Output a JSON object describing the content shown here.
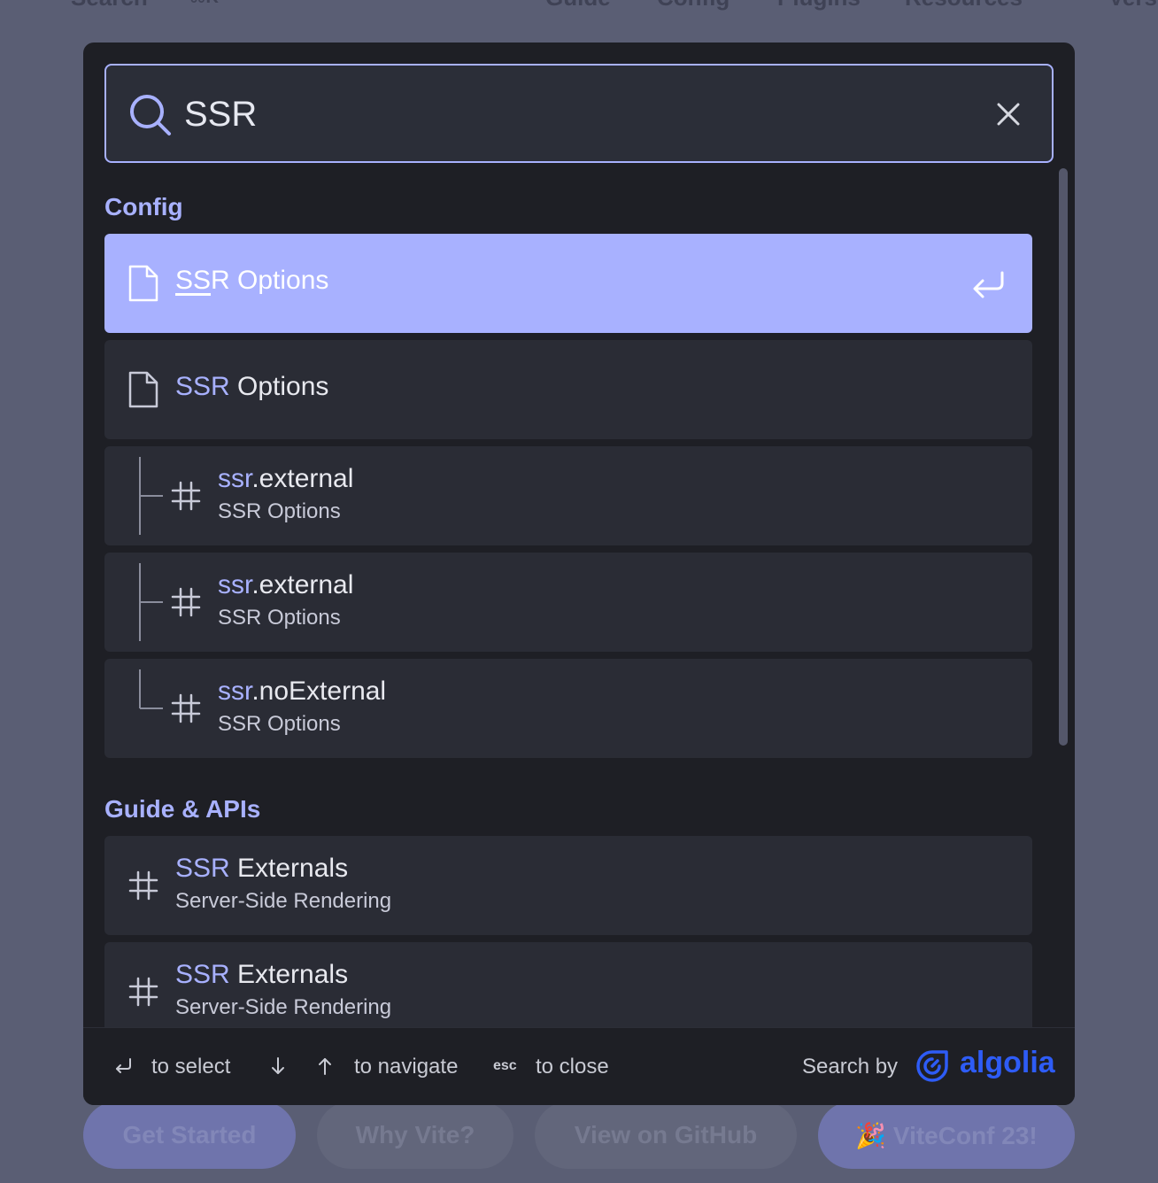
{
  "background": {
    "nav": [
      "Search",
      "⌘K",
      "Guide",
      "Config",
      "Plugins",
      "Resources",
      "Vers"
    ],
    "buttons": [
      "Get Started",
      "Why Vite?",
      "View on GitHub",
      "🎉 ViteConf 23!"
    ]
  },
  "search": {
    "query": "SSR",
    "icon": "search-icon",
    "clear_icon": "close-icon"
  },
  "sections": [
    {
      "title": "Config",
      "items": [
        {
          "type": "page",
          "highlight": "SS",
          "rest": "R Options",
          "selected": true
        },
        {
          "type": "page",
          "highlight": "SSR",
          "rest": " Options"
        },
        {
          "type": "hash",
          "tree": "mid",
          "highlight": "ssr",
          "rest": ".external",
          "subtitle": "SSR Options"
        },
        {
          "type": "hash",
          "tree": "mid",
          "highlight": "ssr",
          "rest": ".external",
          "subtitle": "SSR Options"
        },
        {
          "type": "hash",
          "tree": "end",
          "highlight": "ssr",
          "rest": ".noExternal",
          "subtitle": "SSR Options"
        }
      ]
    },
    {
      "title": "Guide & APIs",
      "items": [
        {
          "type": "hash",
          "highlight": "SSR",
          "rest": " Externals",
          "subtitle": "Server-Side Rendering"
        },
        {
          "type": "hash",
          "highlight": "SSR",
          "rest": " Externals",
          "subtitle": "Server-Side Rendering"
        }
      ]
    }
  ],
  "footer": {
    "select_text": "to select",
    "navigate_text": "to navigate",
    "esc_key": "esc",
    "close_text": "to close",
    "search_by": "Search by",
    "brand": "algolia"
  },
  "colors": {
    "accent": "#a8b1ff",
    "modal_bg": "#1e1f25",
    "item_bg": "#2a2c35",
    "brand": "#2e5cf6"
  }
}
